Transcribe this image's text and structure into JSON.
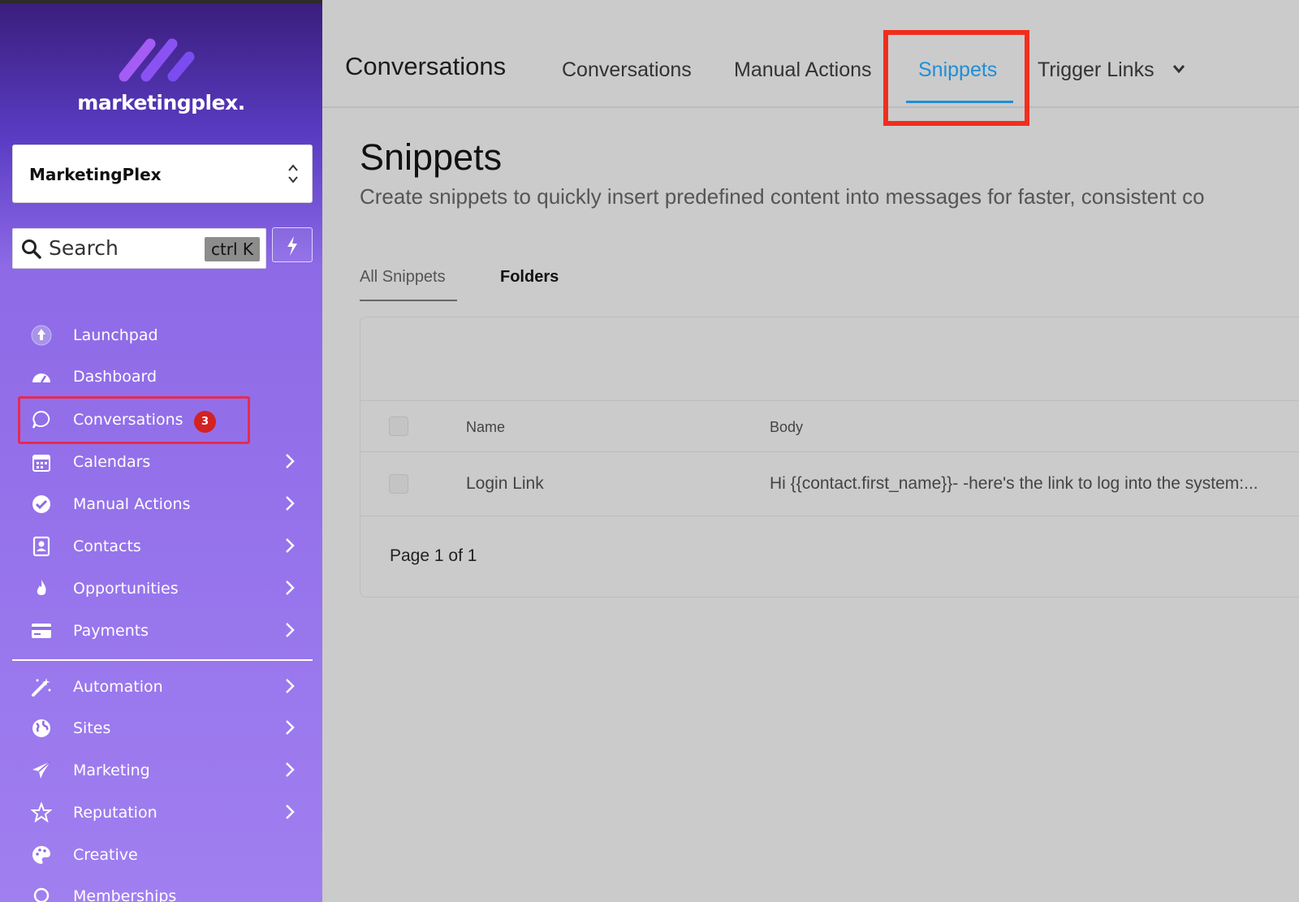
{
  "sidebar": {
    "brand": "marketingplex.",
    "account": "MarketingPlex",
    "search": {
      "placeholder": "Search",
      "shortcut": "ctrl K"
    },
    "items": [
      {
        "label": "Launchpad",
        "icon": "rocket-icon",
        "chevron": false
      },
      {
        "label": "Dashboard",
        "icon": "gauge-icon",
        "chevron": false
      },
      {
        "label": "Conversations",
        "icon": "chat-bubble-icon",
        "chevron": false,
        "badge": "3"
      },
      {
        "label": "Calendars",
        "icon": "calendar-icon",
        "chevron": true
      },
      {
        "label": "Manual Actions",
        "icon": "check-circle-icon",
        "chevron": true
      },
      {
        "label": "Contacts",
        "icon": "contact-card-icon",
        "chevron": true
      },
      {
        "label": "Opportunities",
        "icon": "flame-icon",
        "chevron": true
      },
      {
        "label": "Payments",
        "icon": "credit-card-icon",
        "chevron": true
      },
      {
        "label": "Automation",
        "icon": "magic-wand-icon",
        "chevron": true
      },
      {
        "label": "Sites",
        "icon": "globe-icon",
        "chevron": true
      },
      {
        "label": "Marketing",
        "icon": "paper-plane-icon",
        "chevron": true
      },
      {
        "label": "Reputation",
        "icon": "star-icon",
        "chevron": true
      },
      {
        "label": "Creative",
        "icon": "palette-icon",
        "chevron": false
      },
      {
        "label": "Memberships",
        "icon": "badge-icon",
        "chevron": false
      }
    ]
  },
  "topbar": {
    "title": "Conversations",
    "tabs": [
      {
        "label": "Conversations",
        "active": false
      },
      {
        "label": "Manual Actions",
        "active": false
      },
      {
        "label": "Snippets",
        "active": true
      },
      {
        "label": "Trigger Links",
        "active": false,
        "dropdown": true
      }
    ]
  },
  "page": {
    "title": "Snippets",
    "subtitle": "Create snippets to quickly insert predefined content into messages for faster, consistent co",
    "subtabs": [
      "All Snippets",
      "Folders"
    ],
    "table": {
      "columns": [
        "Name",
        "Body"
      ],
      "rows": [
        {
          "name": "Login Link",
          "body": "Hi {{contact.first_name}}- -here's the link to log into the system:..."
        }
      ],
      "pager": "Page 1 of 1"
    }
  },
  "colors": {
    "accent": "#1e8fd8",
    "annotation_red": "#f22d1d",
    "highlight_pink": "#e62b4f",
    "badge_red": "#d32222"
  }
}
